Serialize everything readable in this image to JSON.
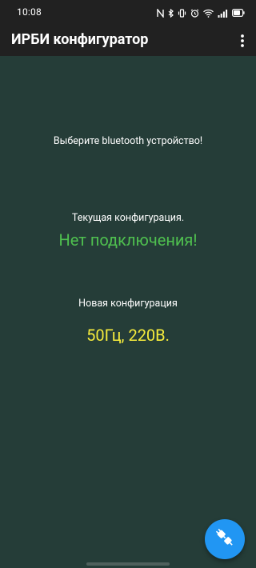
{
  "status_bar": {
    "time": "10:08",
    "battery_level": 0.8,
    "icons": [
      "nfc-icon",
      "bluetooth-icon",
      "vibrate-icon",
      "alarm-icon",
      "wifi-icon",
      "signal-icon",
      "battery-icon"
    ]
  },
  "app_bar": {
    "title": "ИРБИ конфигуратор",
    "menu_icon": "more-vert-icon"
  },
  "main": {
    "prompt": "Выберите bluetooth устройство!",
    "current_label": "Текущая конфигурация.",
    "connection_status": "Нет подключения!",
    "new_label": "Новая конфигурация",
    "new_value": "50Гц, 220В."
  },
  "fab": {
    "icon": "plug-connect-icon"
  },
  "colors": {
    "background": "#253d38",
    "bar": "#212121",
    "status_green": "#4fc04f",
    "value_yellow": "#f6ec3c",
    "fab_blue": "#2196f3"
  }
}
